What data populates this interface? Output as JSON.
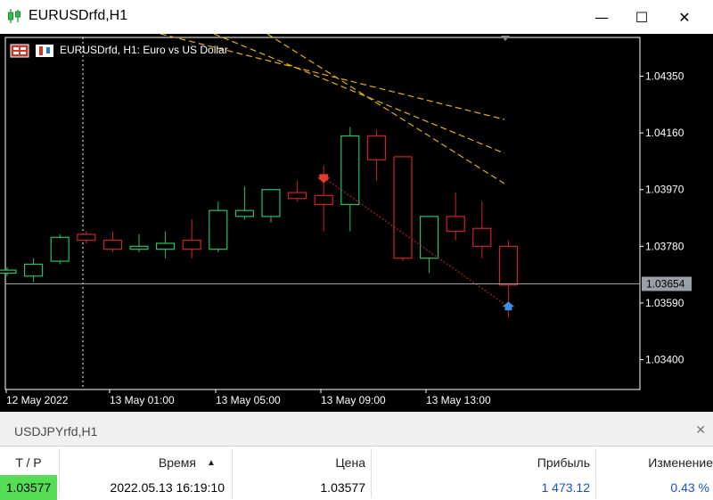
{
  "window": {
    "title": "EURUSDrfd,H1",
    "minimize_glyph": "—",
    "maximize_glyph": "☐",
    "close_glyph": "✕",
    "icon": "candlestick-app-icon"
  },
  "chart": {
    "header_label": "EURUSDrfd, H1:  Euro vs US Dollar",
    "header_icons": [
      "one-click-trading-icon",
      "chart-symbol-icon"
    ],
    "colors": {
      "background": "#000000",
      "bull": "#22c55e",
      "bear": "#d42020",
      "channel": "#e8b100",
      "trade_line": "#d42020",
      "sell_arrow": "#e23c2c",
      "buy_arrow": "#3c8fe2",
      "bid_line": "#9aa0a6",
      "price_label_bg": "#9aa0a6"
    },
    "price_axis_labels": [
      "1.04350",
      "1.04160",
      "1.03970",
      "1.03780",
      "1.03590",
      "1.03400"
    ],
    "time_axis_labels": [
      "12 May 2022",
      "13 May 01:00",
      "13 May 05:00",
      "13 May 09:00",
      "13 May 13:00"
    ],
    "current_price_label": "1.03654"
  },
  "chart_data": {
    "type": "candlestick",
    "y_range": [
      1.033,
      1.0448
    ],
    "current_price": 1.03654,
    "candles": [
      {
        "dir": "bull",
        "open": 1.0369,
        "high": 1.0371,
        "low": 1.0368,
        "close": 1.037
      },
      {
        "dir": "bull",
        "open": 1.0368,
        "high": 1.0374,
        "low": 1.0366,
        "close": 1.0372
      },
      {
        "dir": "bull",
        "open": 1.0373,
        "high": 1.0382,
        "low": 1.0372,
        "close": 1.0381
      },
      {
        "dir": "bear",
        "open": 1.0382,
        "high": 1.0383,
        "low": 1.0379,
        "close": 1.038
      },
      {
        "dir": "bear",
        "open": 1.038,
        "high": 1.0383,
        "low": 1.0376,
        "close": 1.0377
      },
      {
        "dir": "bull",
        "open": 1.0377,
        "high": 1.0382,
        "low": 1.0376,
        "close": 1.0378
      },
      {
        "dir": "bull",
        "open": 1.0377,
        "high": 1.0383,
        "low": 1.0374,
        "close": 1.0379
      },
      {
        "dir": "bear",
        "open": 1.038,
        "high": 1.0387,
        "low": 1.0374,
        "close": 1.0377
      },
      {
        "dir": "bull",
        "open": 1.0377,
        "high": 1.0393,
        "low": 1.0376,
        "close": 1.039
      },
      {
        "dir": "bull",
        "open": 1.0388,
        "high": 1.0398,
        "low": 1.0387,
        "close": 1.039
      },
      {
        "dir": "bull",
        "open": 1.0388,
        "high": 1.0397,
        "low": 1.0386,
        "close": 1.0397
      },
      {
        "dir": "bear",
        "open": 1.0396,
        "high": 1.04,
        "low": 1.0393,
        "close": 1.0394
      },
      {
        "dir": "bear",
        "open": 1.0395,
        "high": 1.0405,
        "low": 1.0383,
        "close": 1.0392
      },
      {
        "dir": "bull",
        "open": 1.0392,
        "high": 1.0418,
        "low": 1.0383,
        "close": 1.0415
      },
      {
        "dir": "bear",
        "open": 1.0415,
        "high": 1.0417,
        "low": 1.04,
        "close": 1.0407
      },
      {
        "dir": "bear",
        "open": 1.0408,
        "high": 1.0408,
        "low": 1.0373,
        "close": 1.0374
      },
      {
        "dir": "bull",
        "open": 1.0374,
        "high": 1.0388,
        "low": 1.0369,
        "close": 1.0388
      },
      {
        "dir": "bear",
        "open": 1.0388,
        "high": 1.0396,
        "low": 1.038,
        "close": 1.0383
      },
      {
        "dir": "bear",
        "open": 1.0384,
        "high": 1.0393,
        "low": 1.0374,
        "close": 1.0378
      },
      {
        "dir": "bear",
        "open": 1.0378,
        "high": 1.038,
        "low": 1.0354,
        "close": 1.0365
      }
    ],
    "trade": {
      "sell_candle": 12,
      "sell_price": 1.0401,
      "buy_candle": 19,
      "buy_price": 1.03577
    }
  },
  "symbol_tab": {
    "label": "USDJPYrfd,H1",
    "close_glyph": "✕"
  },
  "trade_table": {
    "headers": [
      "T / P",
      "Время",
      "Цена",
      "Прибыль",
      "Изменение"
    ],
    "sort_glyph": "▲",
    "row": {
      "tp": "1.03577",
      "time": "2022.05.13 16:19:10",
      "price": "1.03577",
      "profit": "1 473.12",
      "change": "0.43 %"
    },
    "colors": {
      "tp_bg": "#55dd55",
      "profit_text": "#1a4fd6",
      "change_text": "#1a4fd6"
    }
  }
}
